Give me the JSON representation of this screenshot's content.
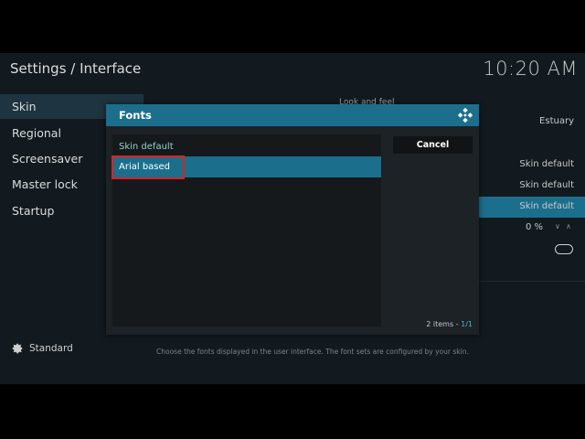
{
  "header": {
    "title": "Settings / Interface",
    "clock": "10:20 AM"
  },
  "sidebar": {
    "items": [
      {
        "label": "Skin",
        "active": true
      },
      {
        "label": "Regional",
        "active": false
      },
      {
        "label": "Screensaver",
        "active": false
      },
      {
        "label": "Master lock",
        "active": false
      },
      {
        "label": "Startup",
        "active": false
      }
    ],
    "level_icon": "gear-icon",
    "level_label": "Standard"
  },
  "main": {
    "section_header": "Look and feel",
    "rows": [
      {
        "value": "Estuary"
      },
      {
        "value": "Skin default"
      },
      {
        "value": "Skin default"
      },
      {
        "value": "Skin default"
      },
      {
        "value": "0 %"
      }
    ],
    "hint": "Choose the fonts displayed in the user interface. The font sets are configured by your skin."
  },
  "dialog": {
    "title": "Fonts",
    "logo_icon": "kodi-logo-icon",
    "options": [
      "Skin default",
      "Arial based"
    ],
    "selected_index": 1,
    "cancel_label": "Cancel",
    "count_text": "2 items - ",
    "count_page": "1/1"
  },
  "colors": {
    "accent": "#1b6f8d",
    "background": "#121a1f",
    "dialog_bg": "#1c2226",
    "highlight_border": "#e02020",
    "first_item_text": "#8fd3c0"
  }
}
